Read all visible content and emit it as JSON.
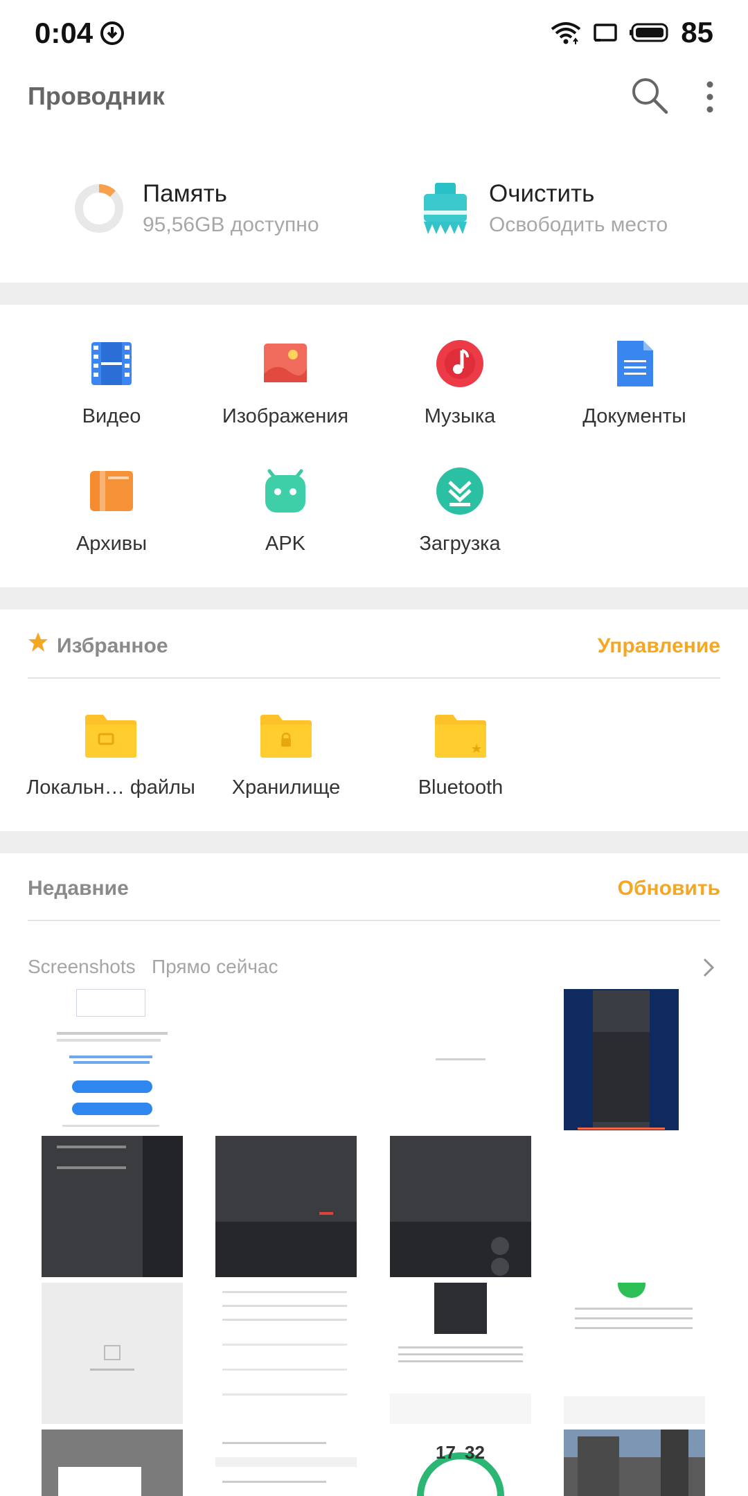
{
  "status_bar": {
    "time": "0:04",
    "battery": "85"
  },
  "app_bar": {
    "title": "Проводник",
    "search_icon": "search-icon",
    "more_icon": "more-vert-icon"
  },
  "storage": {
    "memory": {
      "title": "Память",
      "subtitle": "95,56GB доступно",
      "used_fraction": 0.12
    },
    "cleanup": {
      "title": "Очистить",
      "subtitle": "Освободить место"
    }
  },
  "categories": [
    {
      "label": "Видео",
      "icon": "video-icon"
    },
    {
      "label": "Изображения",
      "icon": "image-icon"
    },
    {
      "label": "Музыка",
      "icon": "music-icon"
    },
    {
      "label": "Документы",
      "icon": "document-icon"
    },
    {
      "label": "Архивы",
      "icon": "archive-icon"
    },
    {
      "label": "APK",
      "icon": "android-icon"
    },
    {
      "label": "Загрузка",
      "icon": "download-icon"
    }
  ],
  "favorites": {
    "title": "Избранное",
    "action": "Управление",
    "items": [
      {
        "label": "Локальн… файлы",
        "icon": "folder-local-icon"
      },
      {
        "label": "Хранилище",
        "icon": "folder-lock-icon"
      },
      {
        "label": "Bluetooth",
        "icon": "folder-star-icon"
      }
    ]
  },
  "recent": {
    "title": "Недавние",
    "action": "Обновить",
    "folder": "Screenshots",
    "time": "Прямо сейчас",
    "thumb_clock": {
      "h": "17",
      "m": "32"
    }
  },
  "colors": {
    "accent": "#f5a623",
    "divider": "#eeeeee"
  }
}
